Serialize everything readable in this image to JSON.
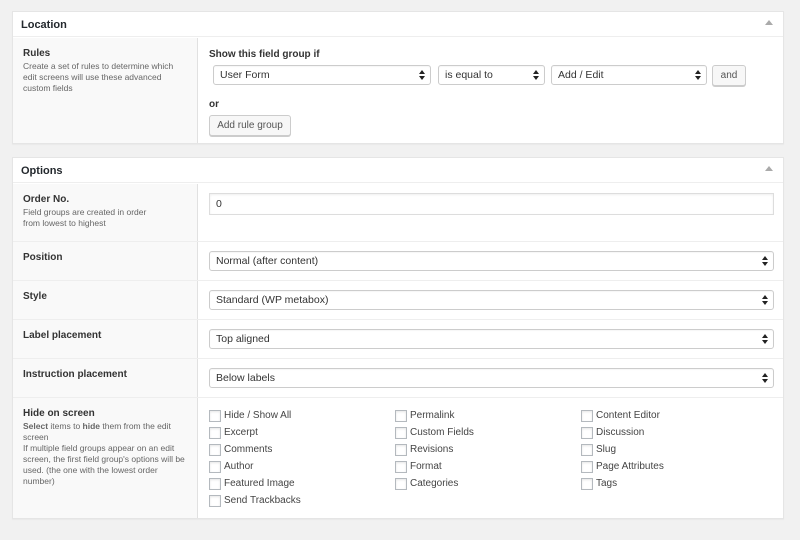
{
  "location": {
    "title": "Location",
    "rules_label": "Rules",
    "rules_desc": "Create a set of rules to determine which edit screens will use these advanced custom fields",
    "show_if": "Show this field group if",
    "param": "User Form",
    "operator": "is equal to",
    "value": "Add / Edit",
    "and_button": "and",
    "or_text": "or",
    "add_rule_group": "Add rule group"
  },
  "options": {
    "title": "Options",
    "order": {
      "label": "Order No.",
      "desc": "Field groups are created in order from lowest to highest",
      "value": "0"
    },
    "position": {
      "label": "Position",
      "value": "Normal (after content)"
    },
    "style": {
      "label": "Style",
      "value": "Standard (WP metabox)"
    },
    "label_placement": {
      "label": "Label placement",
      "value": "Top aligned"
    },
    "instruction_placement": {
      "label": "Instruction placement",
      "value": "Below labels"
    },
    "hide_on_screen": {
      "label": "Hide on screen",
      "desc_select": "Select",
      "desc_mid": " items to ",
      "desc_hide": "hide",
      "desc_end": " them from the edit screen",
      "desc_2": "If multiple field groups appear on an edit screen, the first field group's options will be used. (the one with the lowest order number)",
      "col1": [
        "Hide / Show All",
        "Excerpt",
        "Comments",
        "Author",
        "Featured Image",
        "Send Trackbacks"
      ],
      "col2": [
        "Permalink",
        "Custom Fields",
        "Revisions",
        "Format",
        "Categories"
      ],
      "col3": [
        "Content Editor",
        "Discussion",
        "Slug",
        "Page Attributes",
        "Tags"
      ]
    }
  }
}
